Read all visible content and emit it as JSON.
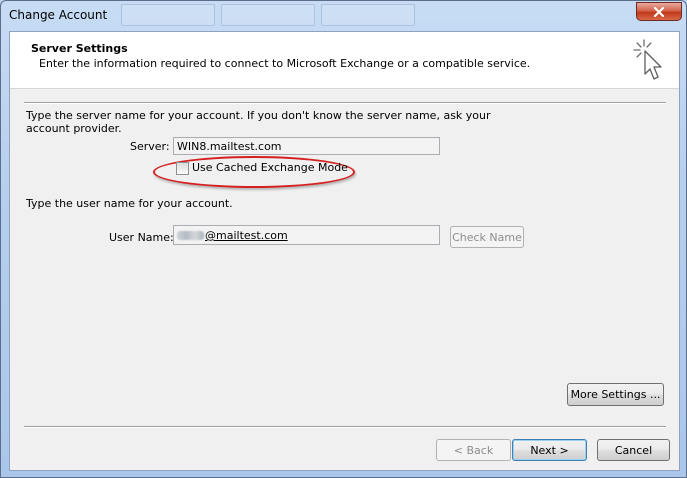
{
  "window": {
    "title": "Change Account"
  },
  "header": {
    "title": "Server Settings",
    "subtitle": "Enter the information required to connect to Microsoft Exchange or a compatible service."
  },
  "server_section": {
    "instruction_line1": "Type the server name for your account. If you don't know the server name, ask your",
    "instruction_line2": "account provider.",
    "server_label": "Server:",
    "server_value": "WIN8.mailtest.com",
    "cached_mode_label": "Use Cached Exchange Mode",
    "cached_mode_checked": false
  },
  "user_section": {
    "instruction": "Type the user name for your account.",
    "user_name_label": "User Name:",
    "user_name_value": "@mailtest.com",
    "check_name_label": "Check Name"
  },
  "buttons": {
    "more_settings": "More Settings ...",
    "back": "< Back",
    "next": "Next >",
    "cancel": "Cancel"
  },
  "colors": {
    "highlight_ring": "#d42020",
    "frame": "#b6cfee"
  }
}
